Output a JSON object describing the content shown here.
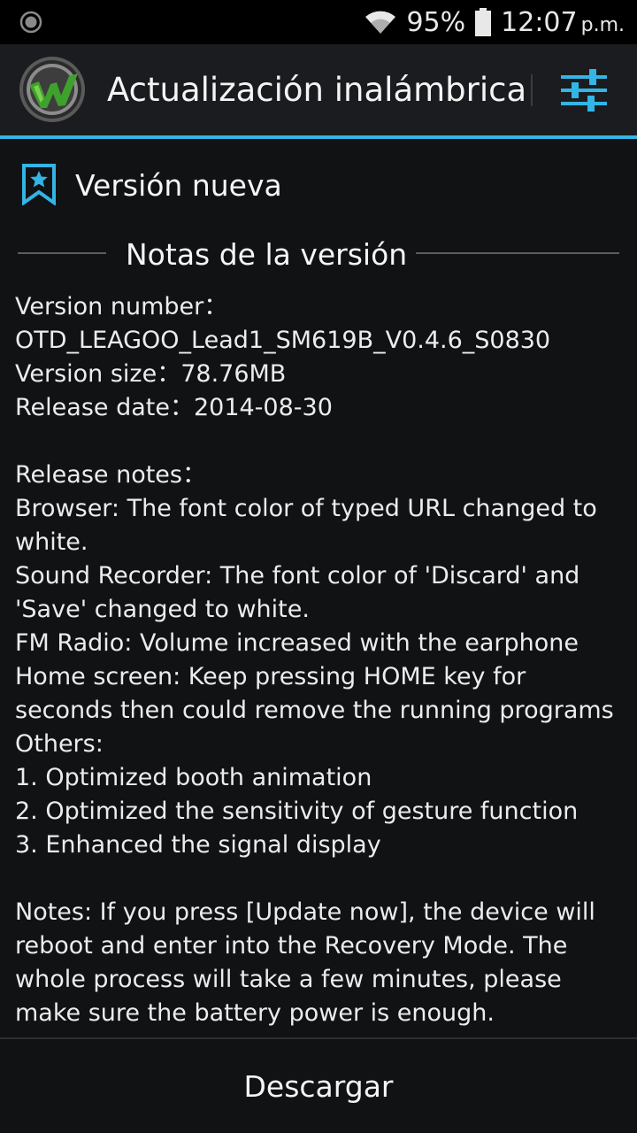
{
  "status_bar": {
    "battery": "95%",
    "time": "12:07",
    "time_suffix": "p.m."
  },
  "action_bar": {
    "title": "Actualización inalámbrica"
  },
  "version_header": {
    "label": "Versión nueva"
  },
  "notes_header": {
    "label": "Notas de la versión"
  },
  "notes": {
    "lines": [
      "Version number：",
      "OTD_LEAGOO_Lead1_SM619B_V0.4.6_S0830",
      "Version size：78.76MB",
      "Release date：2014-08-30",
      "",
      "Release notes：",
      "Browser: The font color of typed URL changed to",
      "white.",
      "Sound Recorder: The font color of 'Discard' and",
      "'Save' changed to white.",
      "FM Radio: Volume increased with the earphone",
      "Home screen: Keep pressing HOME key for",
      "seconds then could remove the running programs",
      "Others:",
      "1. Optimized booth animation",
      "2. Optimized the sensitivity of gesture function",
      "3. Enhanced the signal display",
      "",
      "Notes: If you press [Update now], the device will",
      "reboot and enter into the Recovery Mode. The",
      "whole process will take a few minutes, please",
      "make sure the battery power is enough."
    ]
  },
  "footer": {
    "download_label": "Descargar"
  },
  "colors": {
    "accent": "#33b5e5",
    "background": "#111214",
    "logo_green": "#3a9a2a"
  },
  "icons": {
    "status_left": "notification-circle-icon",
    "wifi": "wifi-icon",
    "battery": "battery-icon",
    "app_logo": "app-logo-icon",
    "settings": "settings-sliders-icon",
    "version": "bookmark-star-icon"
  }
}
